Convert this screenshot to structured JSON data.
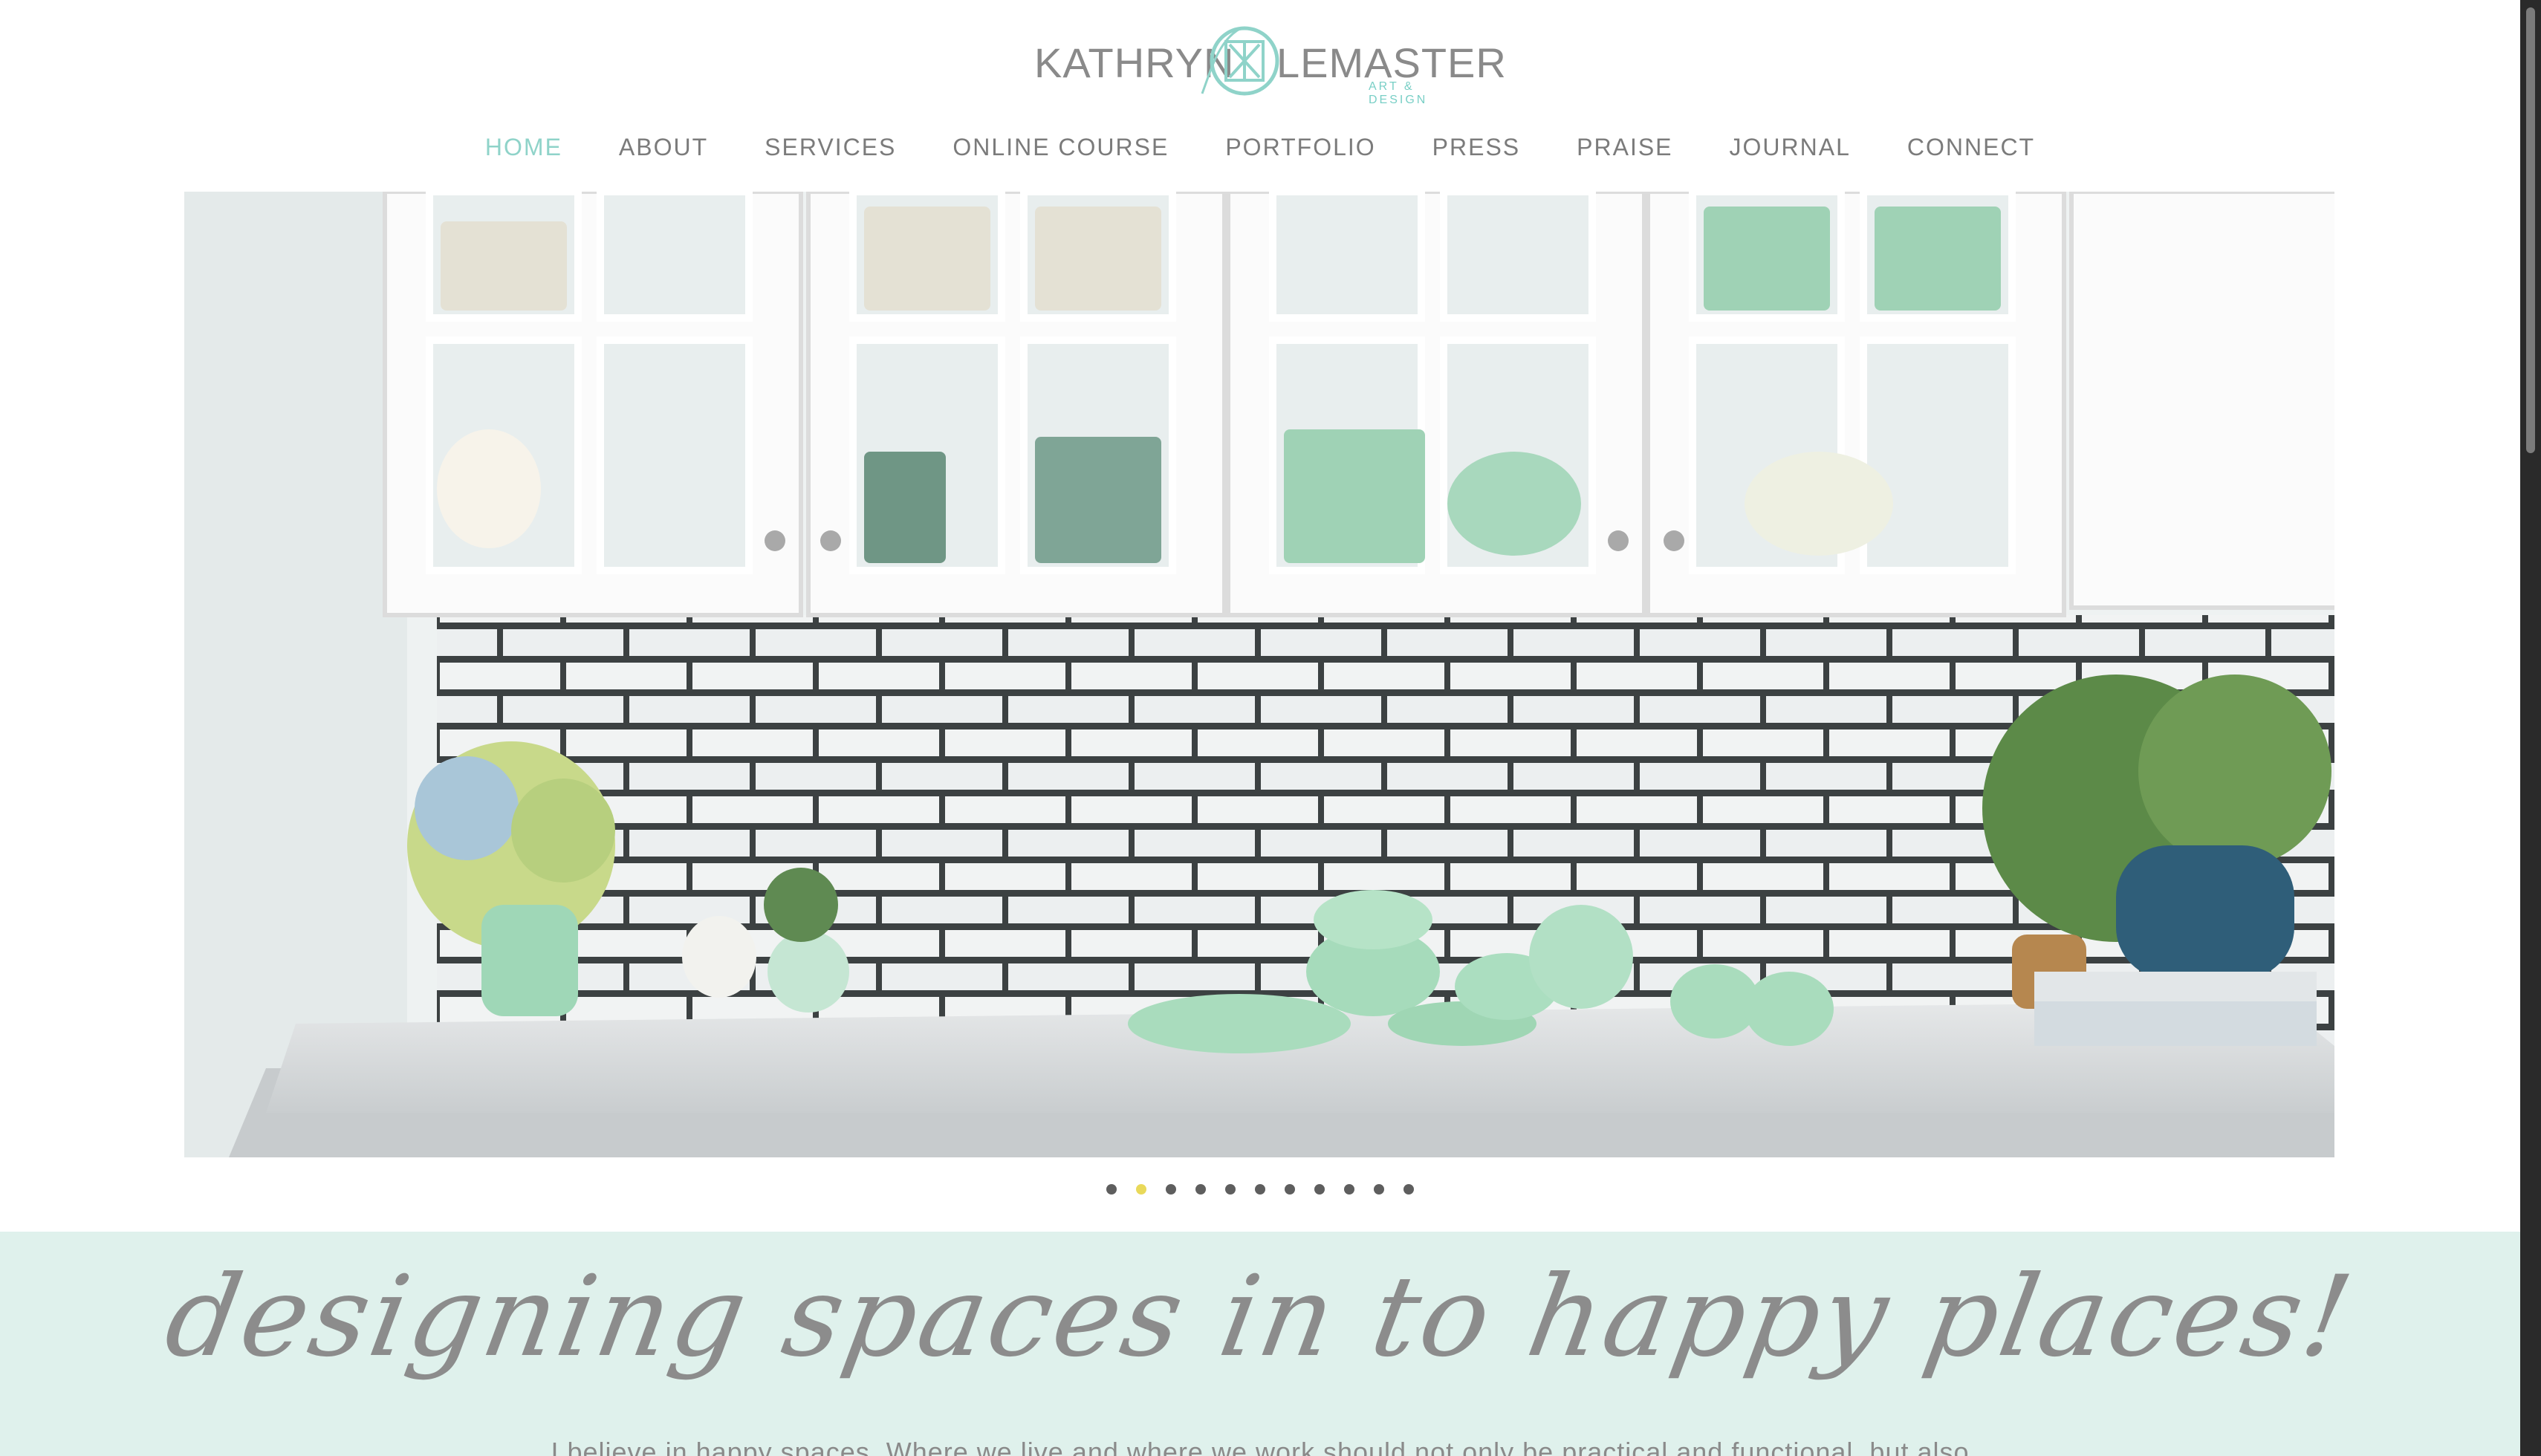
{
  "brand": {
    "name_first": "KATHRYN",
    "name_last": "LEMASTER",
    "tagline": "ART & DESIGN",
    "accent_color": "#8fd3c9"
  },
  "nav": {
    "items": [
      {
        "label": "HOME",
        "active": true
      },
      {
        "label": "ABOUT",
        "active": false
      },
      {
        "label": "SERVICES",
        "active": false
      },
      {
        "label": "ONLINE COURSE",
        "active": false
      },
      {
        "label": "PORTFOLIO",
        "active": false
      },
      {
        "label": "PRESS",
        "active": false
      },
      {
        "label": "PRAISE",
        "active": false
      },
      {
        "label": "JOURNAL",
        "active": false
      },
      {
        "label": "CONNECT",
        "active": false
      }
    ]
  },
  "slider": {
    "slide_count": 11,
    "active_index": 1,
    "active_color": "#e9d95a",
    "image_subject": "white kitchen cabinets with jadeite dishes, subway tile backsplash, hydrangeas and plants on marble counter"
  },
  "intro": {
    "headline": "designing spaces in to happy places!",
    "body": "I believe in happy spaces. Where we live and where we work should not only be practical and functional, but also",
    "background_color": "#dff1ec"
  }
}
